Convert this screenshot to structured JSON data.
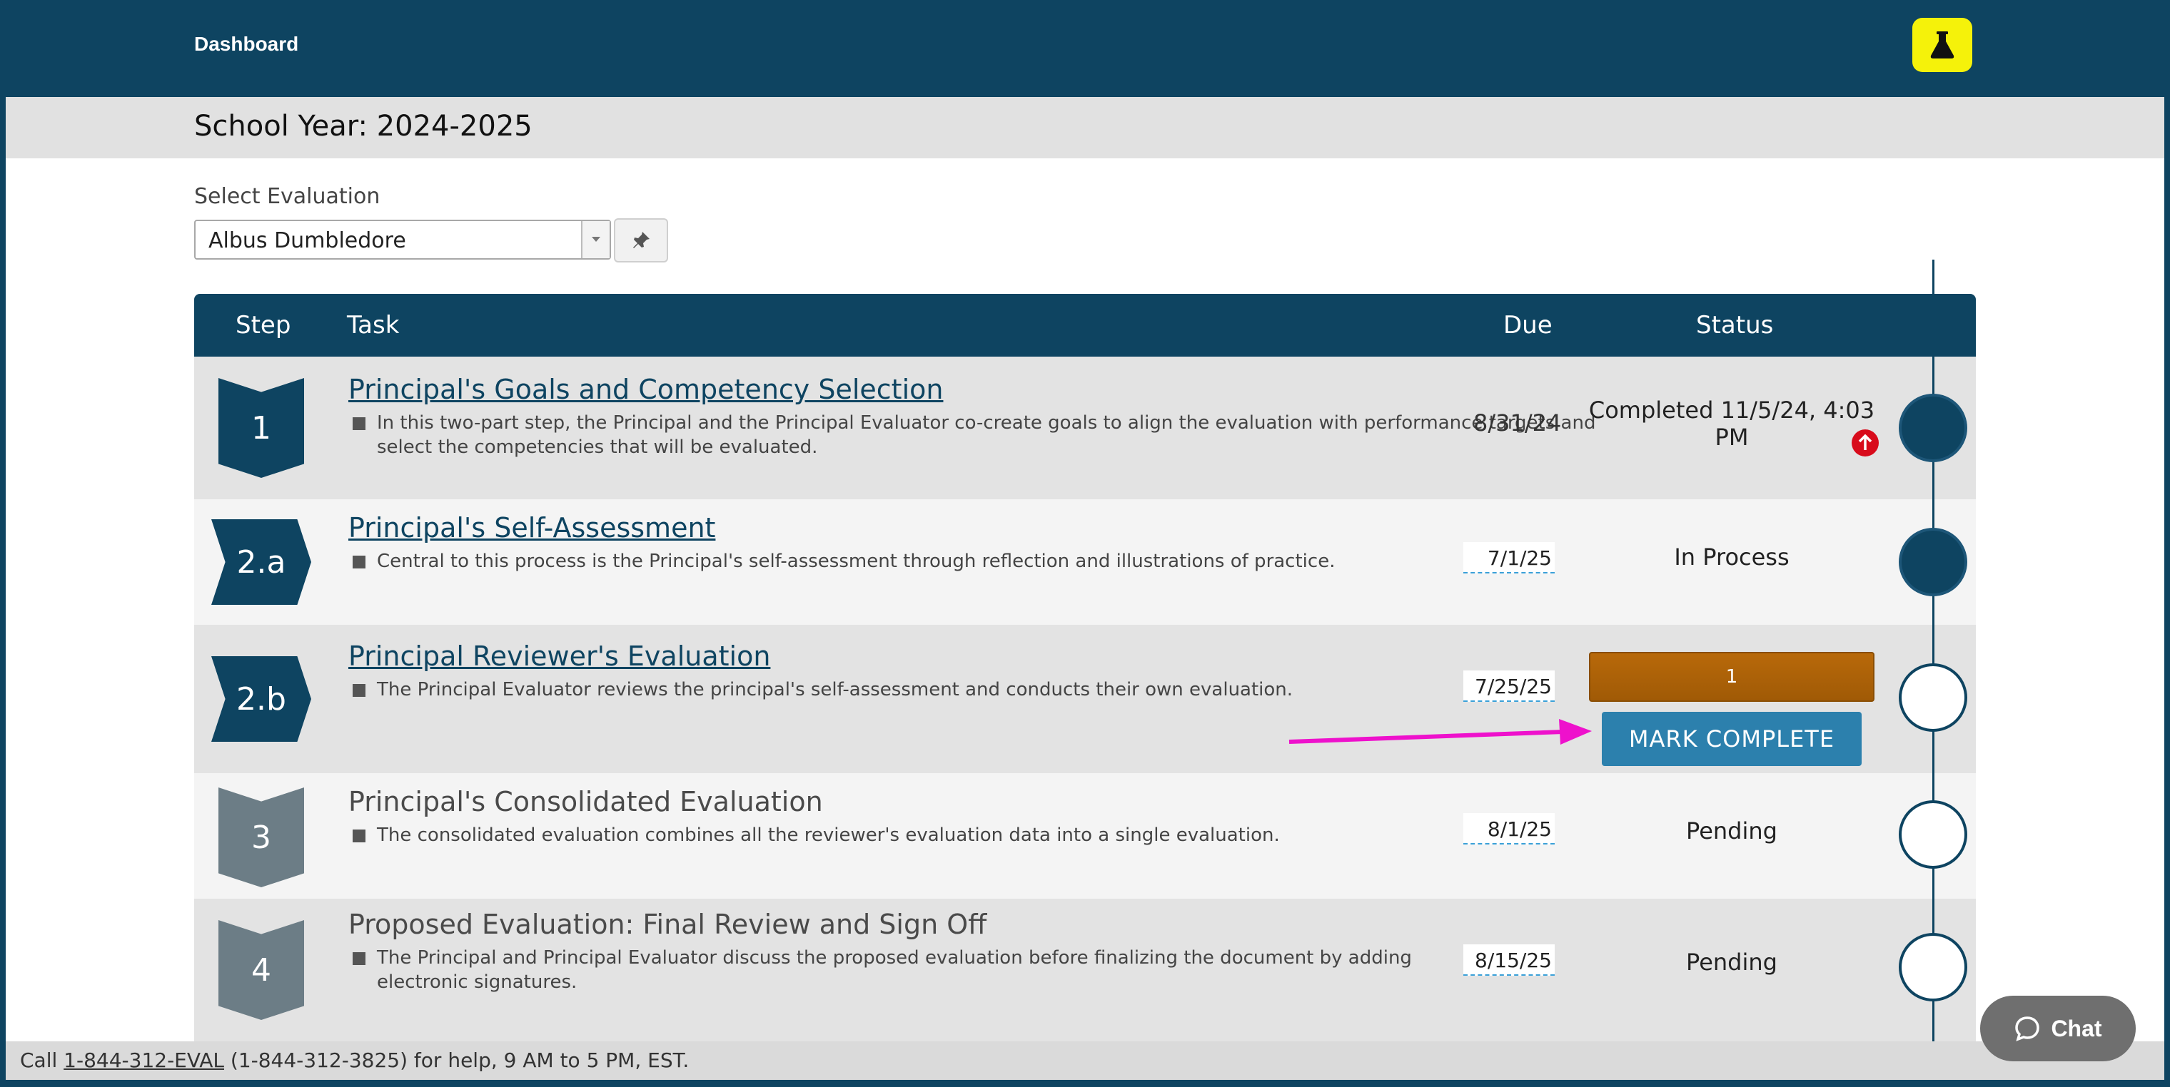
{
  "header": {
    "dashboard_label": "Dashboard",
    "lab_icon": "flask-icon"
  },
  "school_year": "School Year: 2024-2025",
  "select_evaluation": {
    "label": "Select Evaluation",
    "value": "Albus Dumbledore"
  },
  "table": {
    "columns": {
      "step": "Step",
      "task": "Task",
      "due": "Due",
      "status": "Status"
    },
    "rows": [
      {
        "step": "1",
        "title": "Principal's Goals and Competency Selection",
        "desc": "In this two-part step, the Principal and the Principal Evaluator co-create goals to align the evaluation with performance targets and select the competencies that will be evaluated.",
        "due": "8/31/24",
        "status": "Completed 11/5/24, 4:03 PM"
      },
      {
        "step": "2.a",
        "title": "Principal's Self-Assessment",
        "desc": "Central to this process is the Principal's self-assessment through reflection and illustrations of practice.",
        "due": "7/1/25",
        "status": "In Process"
      },
      {
        "step": "2.b",
        "title": "Principal Reviewer's Evaluation",
        "desc": "The Principal Evaluator reviews the principal's self-assessment and conducts their own evaluation.",
        "due": "7/25/25",
        "status_bar": "1",
        "action": "MARK COMPLETE"
      },
      {
        "step": "3",
        "title": "Principal's Consolidated Evaluation",
        "desc": "The consolidated evaluation combines all the reviewer's evaluation data into a single evaluation.",
        "due": "8/1/25",
        "status": "Pending"
      },
      {
        "step": "4",
        "title": "Proposed Evaluation: Final Review and Sign Off",
        "desc": "The Principal and Principal Evaluator discuss the proposed evaluation before finalizing the document by adding electronic signatures.",
        "due": "8/15/25",
        "status": "Pending"
      }
    ]
  },
  "footer": {
    "prefix": "Call ",
    "phone_link": "1-844-312-EVAL",
    "suffix": " (1-844-312-3825) for help, 9 AM to 5 PM, EST."
  },
  "chat": {
    "label": "Chat"
  },
  "colors": {
    "primary": "#0e4461",
    "accent_yellow": "#f5f20a",
    "orange": "#b8690a",
    "button_blue": "#2c80ad",
    "annotation_arrow": "#ee11cc"
  }
}
